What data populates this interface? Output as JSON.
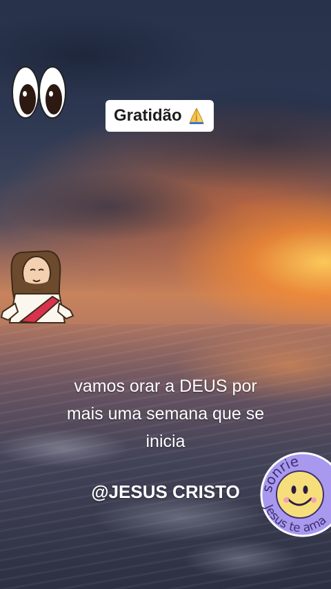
{
  "badge": {
    "text": "Gratidão"
  },
  "caption": {
    "line1": "vamos orar a DEUS por",
    "line2": "mais uma semana que se",
    "line3": "inicia"
  },
  "handle": "@JESUS CRISTO",
  "sticker": {
    "top_text": "sonrie",
    "bottom_text": "Jesus te ama"
  },
  "icons": [
    "eyes-emoji-icon",
    "folded-hands-icon",
    "jesus-sticker",
    "smiley-sticker"
  ],
  "colors": {
    "badge_bg": "#ffffff",
    "caption_text": "#ffffff",
    "sticker_ring": "#9b8ee8",
    "sticker_face": "#f6df7a"
  }
}
